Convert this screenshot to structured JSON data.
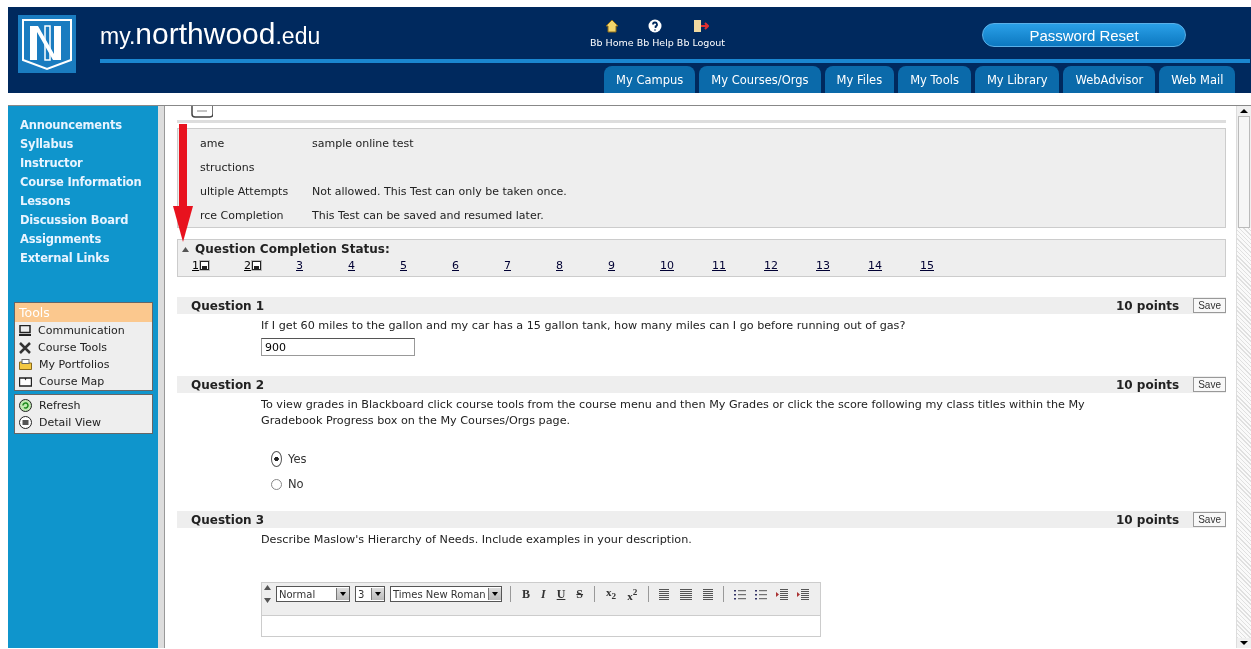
{
  "header": {
    "title": {
      "prefix": "my.",
      "main": "northwood",
      "suffix": ".edu"
    },
    "links": [
      {
        "label": "Bb Home",
        "kind": "home"
      },
      {
        "label": "Bb Help",
        "kind": "help"
      },
      {
        "label": "Bb Logout",
        "kind": "logout"
      }
    ],
    "password_button": "Password Reset",
    "tabs": [
      {
        "label": "My Campus",
        "selected": false
      },
      {
        "label": "My Courses/Orgs",
        "selected": false
      },
      {
        "label": "My Files",
        "selected": false
      },
      {
        "label": "My Tools",
        "selected": false
      },
      {
        "label": "My Library",
        "selected": false
      },
      {
        "label": "WebAdvisor",
        "selected": false
      },
      {
        "label": "Web Mail",
        "selected": false
      }
    ]
  },
  "sidebar": {
    "menu": [
      "Announcements",
      "Syllabus",
      "Instructor",
      "Course Information",
      "Lessons",
      "Discussion Board",
      "Assignments",
      "External Links"
    ],
    "tools": {
      "title": "Tools",
      "items": [
        {
          "label": "Communication",
          "kind": "computer"
        },
        {
          "label": "Course Tools",
          "kind": "tools"
        },
        {
          "label": "My Portfolios",
          "kind": "folder"
        },
        {
          "label": "Course Map",
          "kind": "book"
        }
      ]
    },
    "views": [
      {
        "label": "Refresh",
        "kind": "refresh"
      },
      {
        "label": "Detail View",
        "kind": "detail"
      }
    ]
  },
  "test_info": [
    {
      "label": "ame",
      "value": "sample online test"
    },
    {
      "label": "structions"
    },
    {
      "label": "ultiple Attempts",
      "value": "Not allowed. This Test can only be taken once."
    },
    {
      "label": "rce Completion",
      "value": "This Test can be saved and resumed later."
    }
  ],
  "completion_status": {
    "title": "Question Completion Status:",
    "questions": [
      {
        "number": "1",
        "answered": true
      },
      {
        "number": "2",
        "answered": true
      },
      {
        "number": "3",
        "answered": false
      },
      {
        "number": "4",
        "answered": false
      },
      {
        "number": "5",
        "answered": false
      },
      {
        "number": "6",
        "answered": false
      },
      {
        "number": "7",
        "answered": false
      },
      {
        "number": "8",
        "answered": false
      },
      {
        "number": "9",
        "answered": false
      },
      {
        "number": "10",
        "answered": false
      },
      {
        "number": "11",
        "answered": false
      },
      {
        "number": "12",
        "answered": false
      },
      {
        "number": "13",
        "answered": false
      },
      {
        "number": "14",
        "answered": false
      },
      {
        "number": "15",
        "answered": false
      }
    ]
  },
  "questions": [
    {
      "title": "Question 1",
      "points": "10 points",
      "save": "Save",
      "kind": "fill",
      "text": "If I get 60 miles to the gallon and my car has a 15 gallon tank, how many miles can I go before running out of gas?",
      "answer": "900"
    },
    {
      "title": "Question 2",
      "points": "10 points",
      "save": "Save",
      "kind": "choice",
      "text": "To view grades in Blackboard click course tools from the course menu and then My Grades or click the score following my class titles within the My Gradebook Progress box on the My Courses/Orgs page.",
      "options": [
        {
          "label": "Yes",
          "selected": true
        },
        {
          "label": "No",
          "selected": false
        }
      ]
    },
    {
      "title": "Question 3",
      "points": "10 points",
      "save": "Save",
      "kind": "essay",
      "text": "Describe Maslow's Hierarchy of Needs.  Include examples in your description.",
      "editor": {
        "format": "Normal",
        "size": "3",
        "font": "Times New Roman",
        "buttons": [
          {
            "label": "B",
            "kind": "bold"
          },
          {
            "label": "I",
            "kind": "italic"
          },
          {
            "label": "U",
            "kind": "underline"
          },
          {
            "label": "S",
            "kind": "strike"
          },
          {
            "label": "x$_{2}$",
            "kind": "sub"
          },
          {
            "label": "x$^{2}$",
            "kind": "sup"
          }
        ]
      }
    }
  ]
}
